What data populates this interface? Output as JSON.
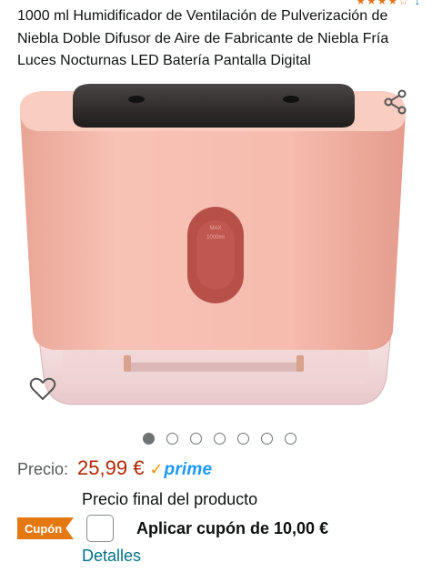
{
  "rating": {
    "stars": "★★★★☆",
    "extra": "↓"
  },
  "product": {
    "title": "1000 ml Humidificador de Ventilación de Pulverización de Niebla Doble Difusor de Aire de Fabricante de Niebla Fría Luces Nocturnas LED Batería Pantalla Digital",
    "image": {
      "window_label_1": "MAX",
      "window_label_2": "1000ml",
      "colors": {
        "body": "#f5b8a8",
        "body_dark": "#e8a090",
        "lid": "#2e2b2b",
        "window": "#b84f48",
        "base": "#f2dada"
      }
    }
  },
  "icons": {
    "share": "share-icon",
    "wishlist": "heart-outline-icon"
  },
  "carousel": {
    "count": 7,
    "active": 0
  },
  "price": {
    "label": "Precio:",
    "value": "25,99 €",
    "prime_check": "✓",
    "prime_text": "prime"
  },
  "final_price_text": "Precio final del producto",
  "coupon": {
    "badge": "Cupón",
    "text": "Aplicar cupón de 10,00 €"
  },
  "details_link": "Detalles",
  "colors": {
    "price": "#b12704",
    "link": "#007185",
    "prime": "#1a98ff",
    "coupon": "#e47911"
  }
}
